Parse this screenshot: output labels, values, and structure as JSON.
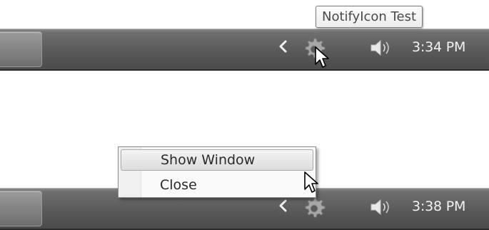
{
  "screens": [
    {
      "tooltip": "NotifyIcon Test",
      "clock": "3:34 PM",
      "tray_icons": [
        "chevron-left-icon",
        "gear-icon",
        "speaker-icon"
      ],
      "cursor": "arrow-cursor"
    },
    {
      "context_menu": {
        "items": [
          "Show Window",
          "Close"
        ],
        "highlighted": "Show Window"
      },
      "clock": "3:38 PM",
      "tray_icons": [
        "chevron-left-icon",
        "gear-icon",
        "speaker-icon"
      ],
      "cursor": "arrow-cursor"
    }
  ],
  "colors": {
    "taskbar": "#5a5a5a",
    "clock_text": "#f2f2f2",
    "tooltip_bg": "#fdfdfd",
    "menu_bg": "#fafafa",
    "menu_highlight": "#dcdcdc"
  }
}
